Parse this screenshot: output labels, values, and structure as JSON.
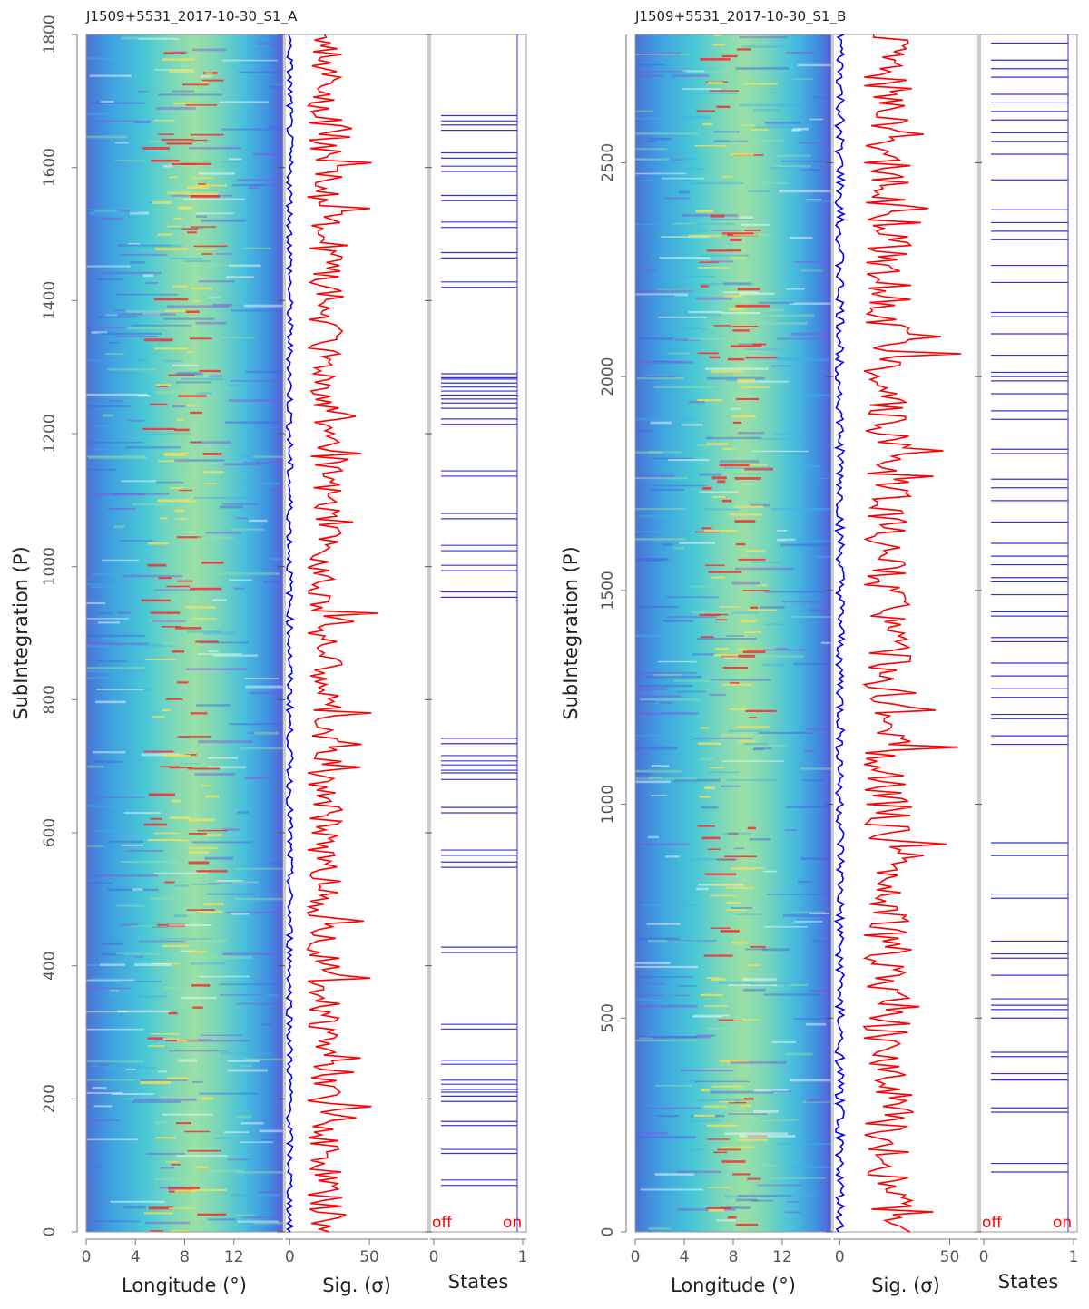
{
  "chart_data": [
    {
      "type": "heatmap",
      "title": "J1509+5531_2017-10-30_S1_A",
      "ylabel": "SubIntegration (P)",
      "ylim": [
        0,
        1800
      ],
      "y_ticks": [
        "0",
        "200",
        "400",
        "600",
        "800",
        "1000",
        "1200",
        "1400",
        "1600",
        "1800"
      ],
      "panels": {
        "longitude": {
          "xlabel": "Longitude (°)",
          "x_ticks": [
            "0",
            "4",
            "8",
            "12"
          ],
          "xlim": [
            0,
            16
          ]
        },
        "significance": {
          "xlabel": "Sig. (σ)",
          "x_ticks": [
            "0",
            "50"
          ],
          "xlim": [
            -3,
            87
          ],
          "series": [
            {
              "color": "#0000ee",
              "mean": 0
            },
            {
              "color": "#ff0000",
              "mean": 22
            }
          ]
        },
        "states": {
          "xlabel": "States",
          "x_ticks": [
            "0",
            "1"
          ],
          "off_label": "off",
          "on_label": "on",
          "off_intervals": [
            [
              70,
              78
            ],
            [
              118,
              124
            ],
            [
              160,
              166
            ],
            [
              196,
              204
            ],
            [
              210,
              214
            ],
            [
              222,
              228
            ],
            [
              252,
              258
            ],
            [
              305,
              312
            ],
            [
              420,
              428
            ],
            [
              548,
              556
            ],
            [
              566,
              574
            ],
            [
              630,
              638
            ],
            [
              680,
              690
            ],
            [
              694,
              702
            ],
            [
              708,
              716
            ],
            [
              734,
              742
            ],
            [
              954,
              962
            ],
            [
              994,
              1002
            ],
            [
              1024,
              1032
            ],
            [
              1072,
              1080
            ],
            [
              1136,
              1144
            ],
            [
              1214,
              1222
            ],
            [
              1238,
              1246
            ],
            [
              1252,
              1258
            ],
            [
              1264,
              1270
            ],
            [
              1276,
              1282
            ],
            [
              1284,
              1290
            ],
            [
              1420,
              1428
            ],
            [
              1464,
              1472
            ],
            [
              1510,
              1518
            ],
            [
              1550,
              1558
            ],
            [
              1594,
              1602
            ],
            [
              1614,
              1622
            ],
            [
              1656,
              1664
            ],
            [
              1670,
              1678
            ]
          ]
        }
      }
    },
    {
      "type": "heatmap",
      "title": "J1509+5531_2017-10-30_S1_B",
      "ylabel": "SubIntegration (P)",
      "ylim": [
        0,
        2800
      ],
      "y_ticks": [
        "0",
        "500",
        "1000",
        "1500",
        "2000",
        "2500"
      ],
      "panels": {
        "longitude": {
          "xlabel": "Longitude (°)",
          "x_ticks": [
            "0",
            "4",
            "8",
            "12"
          ],
          "xlim": [
            0,
            16
          ]
        },
        "significance": {
          "xlabel": "Sig. (σ)",
          "x_ticks": [
            "0",
            "50"
          ],
          "xlim": [
            -3,
            63
          ],
          "series": [
            {
              "color": "#0000ee",
              "mean": 0
            },
            {
              "color": "#ff0000",
              "mean": 22
            }
          ]
        },
        "states": {
          "xlabel": "States",
          "x_ticks": [
            "0",
            "1"
          ],
          "off_label": "off",
          "on_label": "on",
          "off_intervals": [
            [
              140,
              160
            ],
            [
              280,
              290
            ],
            [
              355,
              370
            ],
            [
              410,
              420
            ],
            [
              500,
              520
            ],
            [
              530,
              545
            ],
            [
              600,
              640
            ],
            [
              650,
              680
            ],
            [
              780,
              790
            ],
            [
              880,
              910
            ],
            [
              1140,
              1160
            ],
            [
              1200,
              1210
            ],
            [
              1250,
              1270
            ],
            [
              1300,
              1330
            ],
            [
              1380,
              1390
            ],
            [
              1440,
              1450
            ],
            [
              1490,
              1520
            ],
            [
              1530,
              1560
            ],
            [
              1580,
              1610
            ],
            [
              1660,
              1710
            ],
            [
              1740,
              1760
            ],
            [
              1820,
              1830
            ],
            [
              1900,
              1920
            ],
            [
              1960,
              1990
            ],
            [
              2000,
              2010
            ],
            [
              2050,
              2100
            ],
            [
              2140,
              2150
            ],
            [
              2220,
              2260
            ],
            [
              2320,
              2340
            ],
            [
              2360,
              2390
            ],
            [
              2460,
              2520
            ],
            [
              2550,
              2570
            ],
            [
              2600,
              2620
            ],
            [
              2640,
              2660
            ],
            [
              2700,
              2720
            ],
            [
              2740,
              2780
            ]
          ]
        }
      }
    }
  ]
}
